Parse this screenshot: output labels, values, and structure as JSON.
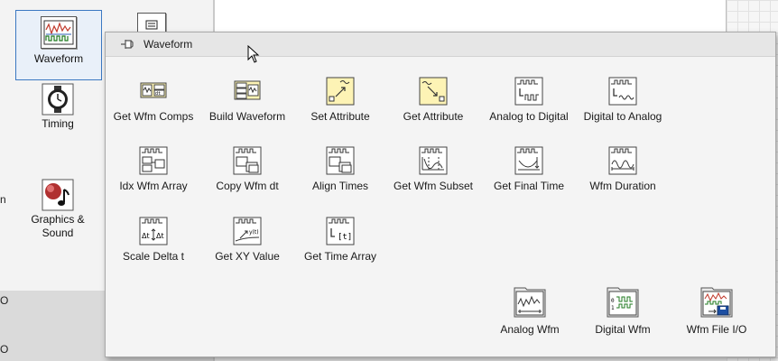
{
  "background_palette": {
    "items": [
      {
        "label": "Waveform",
        "selected": true
      },
      {
        "label": "Timing"
      },
      {
        "label": "Graphics &\nSound"
      }
    ],
    "edge_labels": [
      "n",
      "O",
      "O"
    ]
  },
  "popup": {
    "title": "Waveform",
    "items": [
      {
        "label": "Get Wfm Comps"
      },
      {
        "label": "Build Waveform"
      },
      {
        "label": "Set Attribute"
      },
      {
        "label": "Get Attribute"
      },
      {
        "label": "Analog to Digital"
      },
      {
        "label": "Digital to Analog"
      },
      {
        "label": "Idx Wfm Array"
      },
      {
        "label": "Copy Wfm dt"
      },
      {
        "label": "Align Times"
      },
      {
        "label": "Get Wfm Subset"
      },
      {
        "label": "Get Final Time"
      },
      {
        "label": "Wfm Duration"
      },
      {
        "label": "Scale Delta t"
      },
      {
        "label": "Get XY Value"
      },
      {
        "label": "Get Time Array"
      }
    ],
    "folders": [
      {
        "label": "Analog Wfm"
      },
      {
        "label": "Digital Wfm"
      },
      {
        "label": "Wfm File I/O"
      }
    ]
  },
  "colors": {
    "icon_yellow": "#fdf3b5",
    "selection_border": "#3b78c2",
    "popup_bg": "#f4f4f4"
  }
}
